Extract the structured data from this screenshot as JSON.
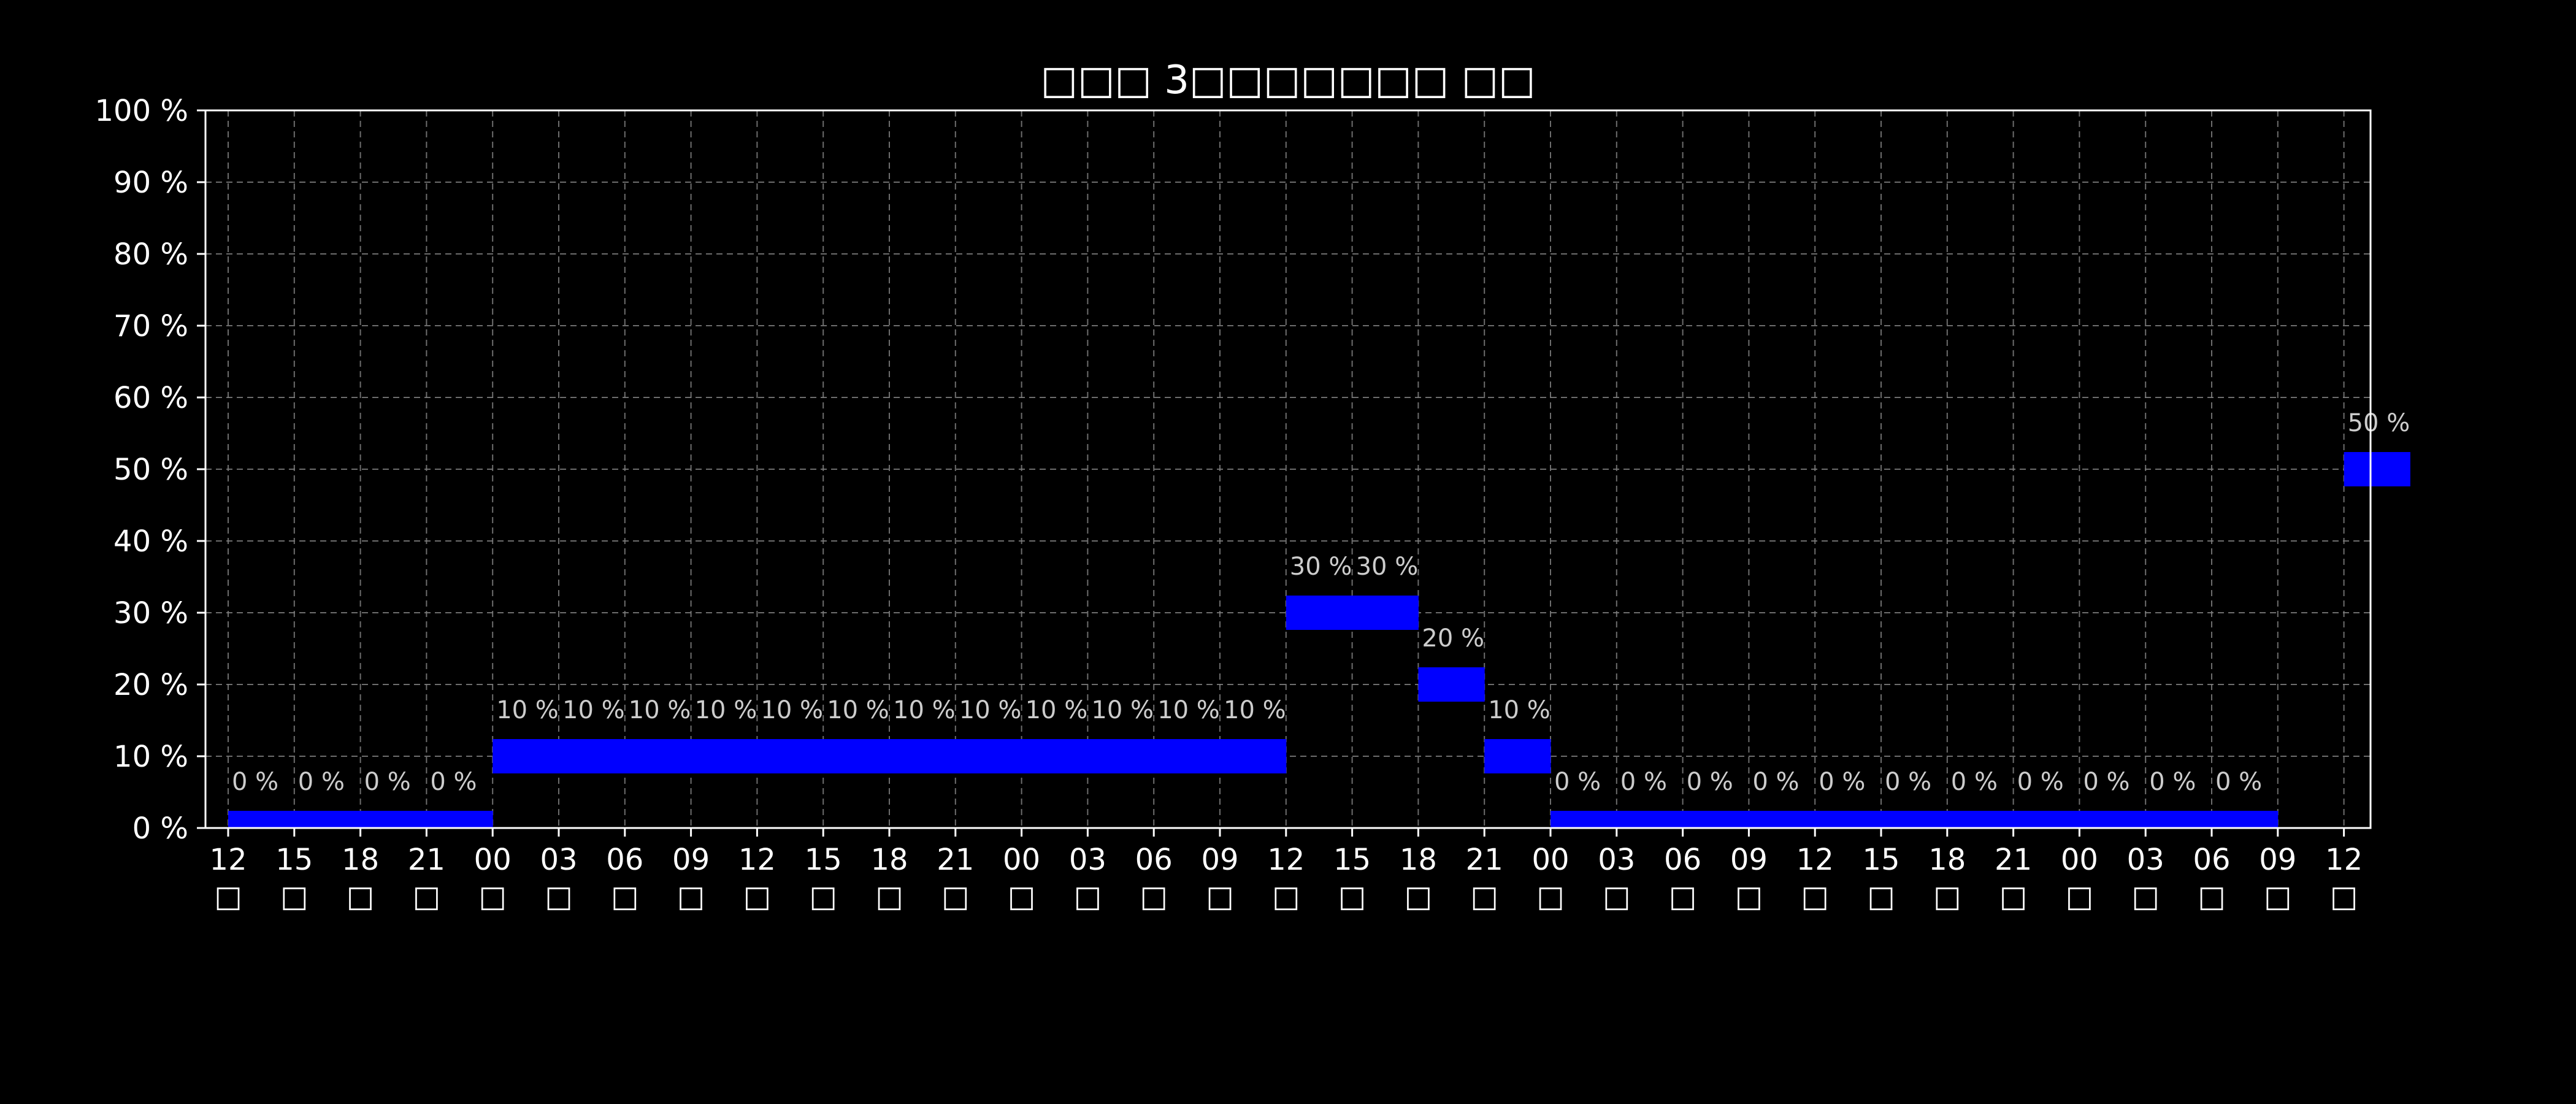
{
  "chart_data": {
    "type": "bar",
    "title": "□□□ 3□□□□□□□ □□",
    "xlabel": "",
    "ylabel": "",
    "ylim": [
      0,
      100
    ],
    "y_unit_suffix": " %",
    "yticks": [
      "0 %",
      "10 %",
      "20 %",
      "30 %",
      "40 %",
      "50 %",
      "60 %",
      "70 %",
      "80 %",
      "90 %",
      "100 %"
    ],
    "grid": true,
    "x_tick_labels": [
      {
        "hour": "12",
        "day": "□"
      },
      {
        "hour": "15",
        "day": "□"
      },
      {
        "hour": "18",
        "day": "□"
      },
      {
        "hour": "21",
        "day": "□"
      },
      {
        "hour": "00",
        "day": "□"
      },
      {
        "hour": "03",
        "day": "□"
      },
      {
        "hour": "06",
        "day": "□"
      },
      {
        "hour": "09",
        "day": "□"
      },
      {
        "hour": "12",
        "day": "□"
      },
      {
        "hour": "15",
        "day": "□"
      },
      {
        "hour": "18",
        "day": "□"
      },
      {
        "hour": "21",
        "day": "□"
      },
      {
        "hour": "00",
        "day": "□"
      },
      {
        "hour": "03",
        "day": "□"
      },
      {
        "hour": "06",
        "day": "□"
      },
      {
        "hour": "09",
        "day": "□"
      },
      {
        "hour": "12",
        "day": "□"
      },
      {
        "hour": "15",
        "day": "□"
      },
      {
        "hour": "18",
        "day": "□"
      },
      {
        "hour": "21",
        "day": "□"
      },
      {
        "hour": "00",
        "day": "□"
      },
      {
        "hour": "03",
        "day": "□"
      },
      {
        "hour": "06",
        "day": "□"
      },
      {
        "hour": "09",
        "day": "□"
      },
      {
        "hour": "12",
        "day": "□"
      },
      {
        "hour": "15",
        "day": "□"
      },
      {
        "hour": "18",
        "day": "□"
      },
      {
        "hour": "21",
        "day": "□"
      },
      {
        "hour": "00",
        "day": "□"
      },
      {
        "hour": "03",
        "day": "□"
      },
      {
        "hour": "06",
        "day": "□"
      },
      {
        "hour": "09",
        "day": "□"
      },
      {
        "hour": "12",
        "day": "□"
      }
    ],
    "values": [
      0,
      0,
      0,
      0,
      10,
      10,
      10,
      10,
      10,
      10,
      10,
      10,
      10,
      10,
      10,
      10,
      30,
      30,
      20,
      10,
      0,
      0,
      0,
      0,
      0,
      0,
      0,
      0,
      0,
      0,
      0,
      null,
      50
    ],
    "value_labels": [
      "0 %",
      "0 %",
      "0 %",
      "0 %",
      "10 %",
      "10 %",
      "10 %",
      "10 %",
      "10 %",
      "10 %",
      "10 %",
      "10 %",
      "10 %",
      "10 %",
      "10 %",
      "10 %",
      "30 %",
      "30 %",
      "20 %",
      "10 %",
      "0 %",
      "0 %",
      "0 %",
      "0 %",
      "0 %",
      "0 %",
      "0 %",
      "0 %",
      "0 %",
      "0 %",
      "0 %",
      "",
      "50 %"
    ],
    "colors": {
      "background": "#000000",
      "bar": "#0000ff",
      "text": "#ffffff",
      "label": "#cccccc",
      "grid": "#808080",
      "axes": "#ffffff"
    }
  }
}
